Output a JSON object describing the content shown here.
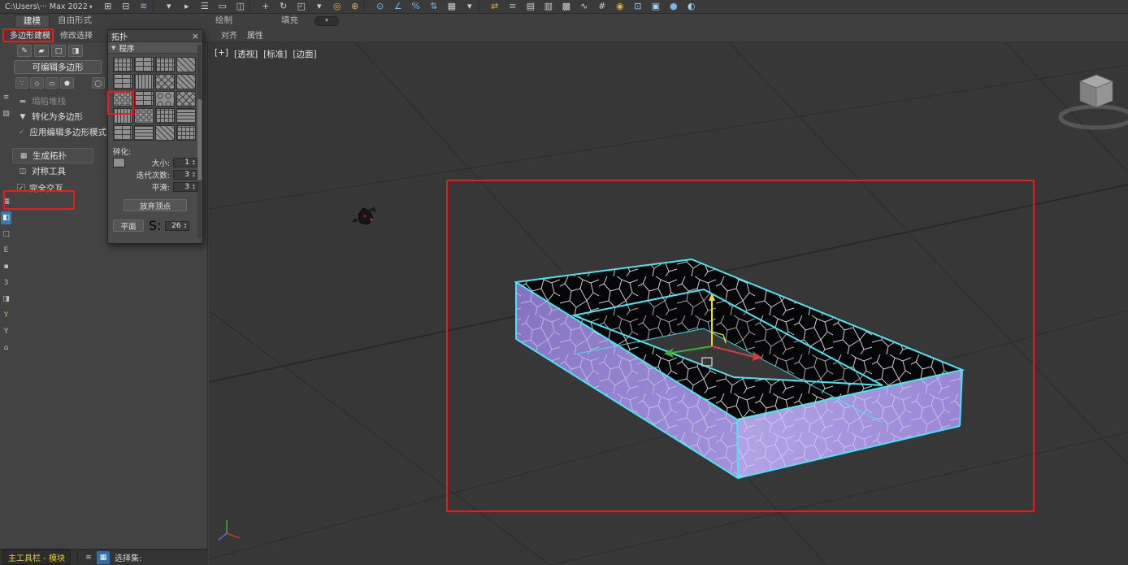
{
  "colors": {
    "viewport_bg": "#373737",
    "wall_purple": "#9c8bd6",
    "selection_edge_cyan": "#49e6f2",
    "annotation_red": "#ea1b1b",
    "topology_face_black": "#060608",
    "status_label_yellow": "#e6cf3f"
  },
  "titlebar": {
    "path": "C:\\Users\\··· Max 2022",
    "caret": "▾",
    "icons": [
      {
        "name": "select-and-link-icon",
        "glyph": "⊞"
      },
      {
        "name": "unlink-selection-icon",
        "glyph": "⊟"
      },
      {
        "name": "bind-to-space-warp-icon",
        "glyph": "≋",
        "cls": "blue"
      },
      {
        "name": "toolbar-separator",
        "glyph": "▏",
        "cls": "sep"
      },
      {
        "name": "selection-filter-dropdown-icon",
        "glyph": "▾"
      },
      {
        "name": "select-object-icon",
        "glyph": "▸"
      },
      {
        "name": "select-by-name-icon",
        "glyph": "☰"
      },
      {
        "name": "select-region-icon",
        "glyph": "▭"
      },
      {
        "name": "window-crossing-icon",
        "glyph": "◫"
      },
      {
        "name": "toolbar-separator",
        "glyph": "▏",
        "cls": "sep"
      },
      {
        "name": "select-and-move-icon",
        "glyph": "+"
      },
      {
        "name": "select-and-rotate-icon",
        "glyph": "↻"
      },
      {
        "name": "select-and-scale-icon",
        "glyph": "◰"
      },
      {
        "name": "reference-coordinate-dropdown-icon",
        "glyph": "▾"
      },
      {
        "name": "use-pivot-center-icon",
        "glyph": "◎",
        "cls": "gold"
      },
      {
        "name": "select-and-manipulate-icon",
        "glyph": "⊕",
        "cls": "gold"
      },
      {
        "name": "toolbar-separator",
        "glyph": "▏",
        "cls": "sep"
      },
      {
        "name": "snaps-toggle-icon",
        "glyph": "⊙",
        "cls": "blue"
      },
      {
        "name": "angle-snap-icon",
        "glyph": "∠",
        "cls": "blue"
      },
      {
        "name": "percent-snap-icon",
        "glyph": "%",
        "cls": "blue"
      },
      {
        "name": "spinner-snap-icon",
        "glyph": "⇅",
        "cls": "blue"
      },
      {
        "name": "edit-selection-sets-icon",
        "glyph": "▦"
      },
      {
        "name": "named-sets-dropdown-icon",
        "glyph": "▾"
      },
      {
        "name": "toolbar-separator",
        "glyph": "▏",
        "cls": "sep"
      },
      {
        "name": "mirror-icon",
        "glyph": "⇄",
        "cls": "gold"
      },
      {
        "name": "align-icon",
        "glyph": "≡",
        "cls": "gold"
      },
      {
        "name": "layer-explorer-icon",
        "glyph": "▤"
      },
      {
        "name": "scene-explorer-icon",
        "glyph": "▥"
      },
      {
        "name": "ribbon-toggle-icon",
        "glyph": "▩"
      },
      {
        "name": "curve-editor-icon",
        "glyph": "∿"
      },
      {
        "name": "schematic-view-icon",
        "glyph": "#"
      },
      {
        "name": "material-editor-icon",
        "glyph": "◉",
        "cls": "gold"
      },
      {
        "name": "render-setup-icon",
        "glyph": "⊡",
        "cls": "sky"
      },
      {
        "name": "rendered-frame-icon",
        "glyph": "▣",
        "cls": "sky"
      },
      {
        "name": "render-production-icon",
        "glyph": "●",
        "cls": "blue"
      },
      {
        "name": "render-iterative-icon",
        "glyph": "◐",
        "cls": "sky"
      }
    ]
  },
  "ribbon": {
    "tabs": [
      {
        "name": "tab-modeling",
        "label": "建模",
        "cls": "active"
      },
      {
        "name": "tab-freeform",
        "label": "自由形式"
      },
      {
        "name": "tab-object-paint",
        "label": "绘制",
        "cls": "ml-lg"
      },
      {
        "name": "tab-populate",
        "label": "填充",
        "cls": "ml-sm"
      }
    ],
    "overflow_caret": "▾",
    "panel_tabs": [
      {
        "name": "panel-tab-polygon-modeling",
        "label": "多边形建模",
        "cls": "active"
      },
      {
        "name": "panel-tab-modify-selection",
        "label": "修改选择"
      },
      {
        "name": "panel-tab-align",
        "label": "对齐",
        "cls": "ml-xl"
      },
      {
        "name": "panel-tab-properties",
        "label": "属性"
      }
    ]
  },
  "polygon_panel": {
    "tool_buttons": [
      {
        "name": "pencil-tool-button",
        "glyph": "✎"
      },
      {
        "name": "marker-tool-button",
        "glyph": "▰"
      },
      {
        "name": "square-swatch-button",
        "glyph": "□"
      },
      {
        "name": "half-swatch-button",
        "glyph": "◨"
      }
    ],
    "dropdown_label": "可编辑多边形",
    "subobject_buttons": [
      {
        "name": "vertex-mode-button",
        "glyph": "∵"
      },
      {
        "name": "edge-mode-button",
        "glyph": "◇"
      },
      {
        "name": "border-mode-button",
        "glyph": "▭"
      },
      {
        "name": "polygon-mode-button",
        "glyph": "⬟"
      },
      {
        "name": "element-mode-button",
        "glyph": "◯"
      }
    ],
    "menu_items": [
      {
        "name": "collapse-stack-item",
        "icon_name": "collapse-stack-icon",
        "icon": "▬",
        "icon_style": "color:#9a9a9a",
        "label": "塌陷堆栈",
        "cls": "disabled"
      },
      {
        "name": "convert-to-poly-item",
        "icon_name": "convert-to-poly-icon",
        "icon": "▼",
        "icon_style": "color:#cfcfcf",
        "label": "转化为多边形"
      },
      {
        "name": "apply-edit-poly-item",
        "icon_name": "green-check-icon",
        "icon": "✓",
        "icon_style": "color:#5dbb4d",
        "label": "应用编辑多边形模式"
      },
      {
        "name": "generate-topology-item",
        "icon_name": "topology-grid-icon",
        "icon": "▦",
        "icon_style": "color:#cfcfcf",
        "label": "生成拓扑",
        "cls": "gap-top"
      },
      {
        "name": "symmetry-tools-item",
        "icon_name": "symmetry-icon",
        "icon": "◫",
        "icon_style": "color:#cfcfcf",
        "label": "对称工具"
      }
    ],
    "checkbox": {
      "label": "完全交互",
      "checked": true,
      "check_glyph": "✓"
    }
  },
  "topology": {
    "title": "拓扑",
    "close_glyph": "×",
    "section_caret": "▼",
    "section_label": "程序",
    "tiles": [
      {
        "name": "topology-pattern-tile-1",
        "cls": "p1"
      },
      {
        "name": "topology-pattern-tile-2",
        "cls": "p2"
      },
      {
        "name": "topology-pattern-tile-3",
        "cls": "p1"
      },
      {
        "name": "topology-pattern-tile-4",
        "cls": "p3"
      },
      {
        "name": "topology-pattern-tile-5",
        "cls": "p2"
      },
      {
        "name": "topology-pattern-tile-6",
        "cls": "p6"
      },
      {
        "name": "topology-pattern-tile-7",
        "cls": "p4"
      },
      {
        "name": "topology-pattern-tile-8",
        "cls": "p3"
      },
      {
        "name": "topology-pattern-tile-9",
        "cls": "p5"
      },
      {
        "name": "topology-pattern-tile-10",
        "cls": "p2"
      },
      {
        "name": "topology-pattern-tile-11",
        "cls": "p8"
      },
      {
        "name": "topology-pattern-tile-12",
        "cls": "p4"
      },
      {
        "name": "topology-pattern-tile-13",
        "cls": "p6"
      },
      {
        "name": "topology-pattern-tile-14",
        "cls": "p5"
      },
      {
        "name": "topology-pattern-tile-15",
        "cls": "p1"
      },
      {
        "name": "topology-pattern-tile-16",
        "cls": "p7"
      },
      {
        "name": "topology-pattern-tile-17",
        "cls": "p2"
      },
      {
        "name": "topology-pattern-tile-18",
        "cls": "p7"
      },
      {
        "name": "topology-pattern-tile-19",
        "cls": "p3"
      },
      {
        "name": "topology-pattern-tile-20",
        "cls": "p1"
      }
    ],
    "shatter_label": "碎化:",
    "params": [
      {
        "label": "大小:",
        "value": "1",
        "cls": "has-icon",
        "label_name": "size-label",
        "input_name": "size-spinner"
      },
      {
        "label": "迭代次数:",
        "value": "3",
        "label_name": "iterations-label",
        "input_name": "iterations-spinner"
      },
      {
        "label": "平滑:",
        "value": "3",
        "label_name": "smooth-label",
        "input_name": "smooth-spinner"
      }
    ],
    "spinner_up": "▴",
    "spinner_down": "▾",
    "discard_button": "放弃顶点",
    "plane_button": "平面",
    "s_label": "S:",
    "s_value": "26"
  },
  "dock": {
    "icons": [
      {
        "name": "notes-list-icon",
        "glyph": "≡"
      },
      {
        "name": "eraser-icon",
        "glyph": "▨"
      },
      {
        "name": "grid-display-icon",
        "glyph": "▦",
        "cls": "g1"
      },
      {
        "name": "active-tool-icon",
        "glyph": "◧",
        "cls": "selected"
      },
      {
        "name": "square-tool-icon",
        "glyph": "□"
      },
      {
        "name": "element-e-icon",
        "glyph": "E"
      },
      {
        "name": "solid-square-icon",
        "glyph": "▪"
      },
      {
        "name": "numeric-3-icon",
        "glyph": "3"
      },
      {
        "name": "half-square-icon",
        "glyph": "◨"
      },
      {
        "name": "filter-icon",
        "glyph": "Y",
        "cls": "gold"
      },
      {
        "name": "filter-secondary-icon",
        "glyph": "Y"
      },
      {
        "name": "home-icon",
        "glyph": "⌂"
      }
    ]
  },
  "statusbar": {
    "label": "主工具栏 - 模块",
    "icons": [
      {
        "name": "toolbar-anchor-icon",
        "glyph": "≋"
      },
      {
        "name": "module-grid-icon",
        "glyph": "▦",
        "cls": "selected"
      }
    ],
    "selection_label": "选择集:"
  },
  "viewport": {
    "labels": [
      {
        "name": "viewport-general-menu",
        "text": "[+]"
      },
      {
        "name": "viewport-pov-menu",
        "text": "[透视]"
      },
      {
        "name": "viewport-standard-menu",
        "text": "[标准]"
      },
      {
        "name": "viewport-shading-menu",
        "text": "[边面]"
      }
    ]
  },
  "scene": {
    "object": "voronoi-wall-frame",
    "selection_highlight": "#49e6f2",
    "wall_color": "#9c8bd6",
    "top_faces": "black-with-white-voronoi-wireframe",
    "gizmo_axes": [
      "x-red",
      "y-green",
      "z-yellow"
    ]
  }
}
